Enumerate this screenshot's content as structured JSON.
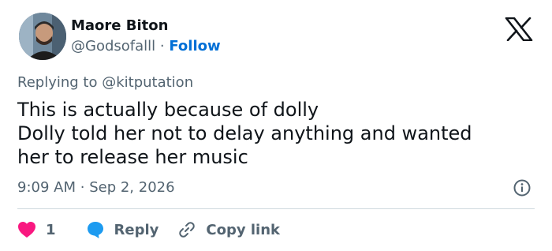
{
  "user": {
    "name": "Maore Biton",
    "handle": "@Godsofalll",
    "separator": "·",
    "follow_label": "Follow"
  },
  "reply": {
    "prefix": "Replying to",
    "mention": "@kitputation"
  },
  "tweet": {
    "lines": [
      "This is actually because of dolly",
      "Dolly told her not to delay anything and wanted",
      "her to release her music"
    ]
  },
  "meta": {
    "time": "9:09 AM",
    "separator": "·",
    "date": "Sep 2, 2026"
  },
  "actions": {
    "like_count": "1",
    "reply_label": "Reply",
    "copy_link_label": "Copy link"
  },
  "icons": {
    "brand": "x-logo-icon",
    "info": "info-icon",
    "like": "heart-icon",
    "reply": "speech-bubble-icon",
    "copy": "link-icon"
  },
  "colors": {
    "follow": "#006fd6",
    "secondary_text": "#536471",
    "heart": "#f91880",
    "reply_bubble": "#1d9bf0",
    "divider": "#cfd9de"
  }
}
